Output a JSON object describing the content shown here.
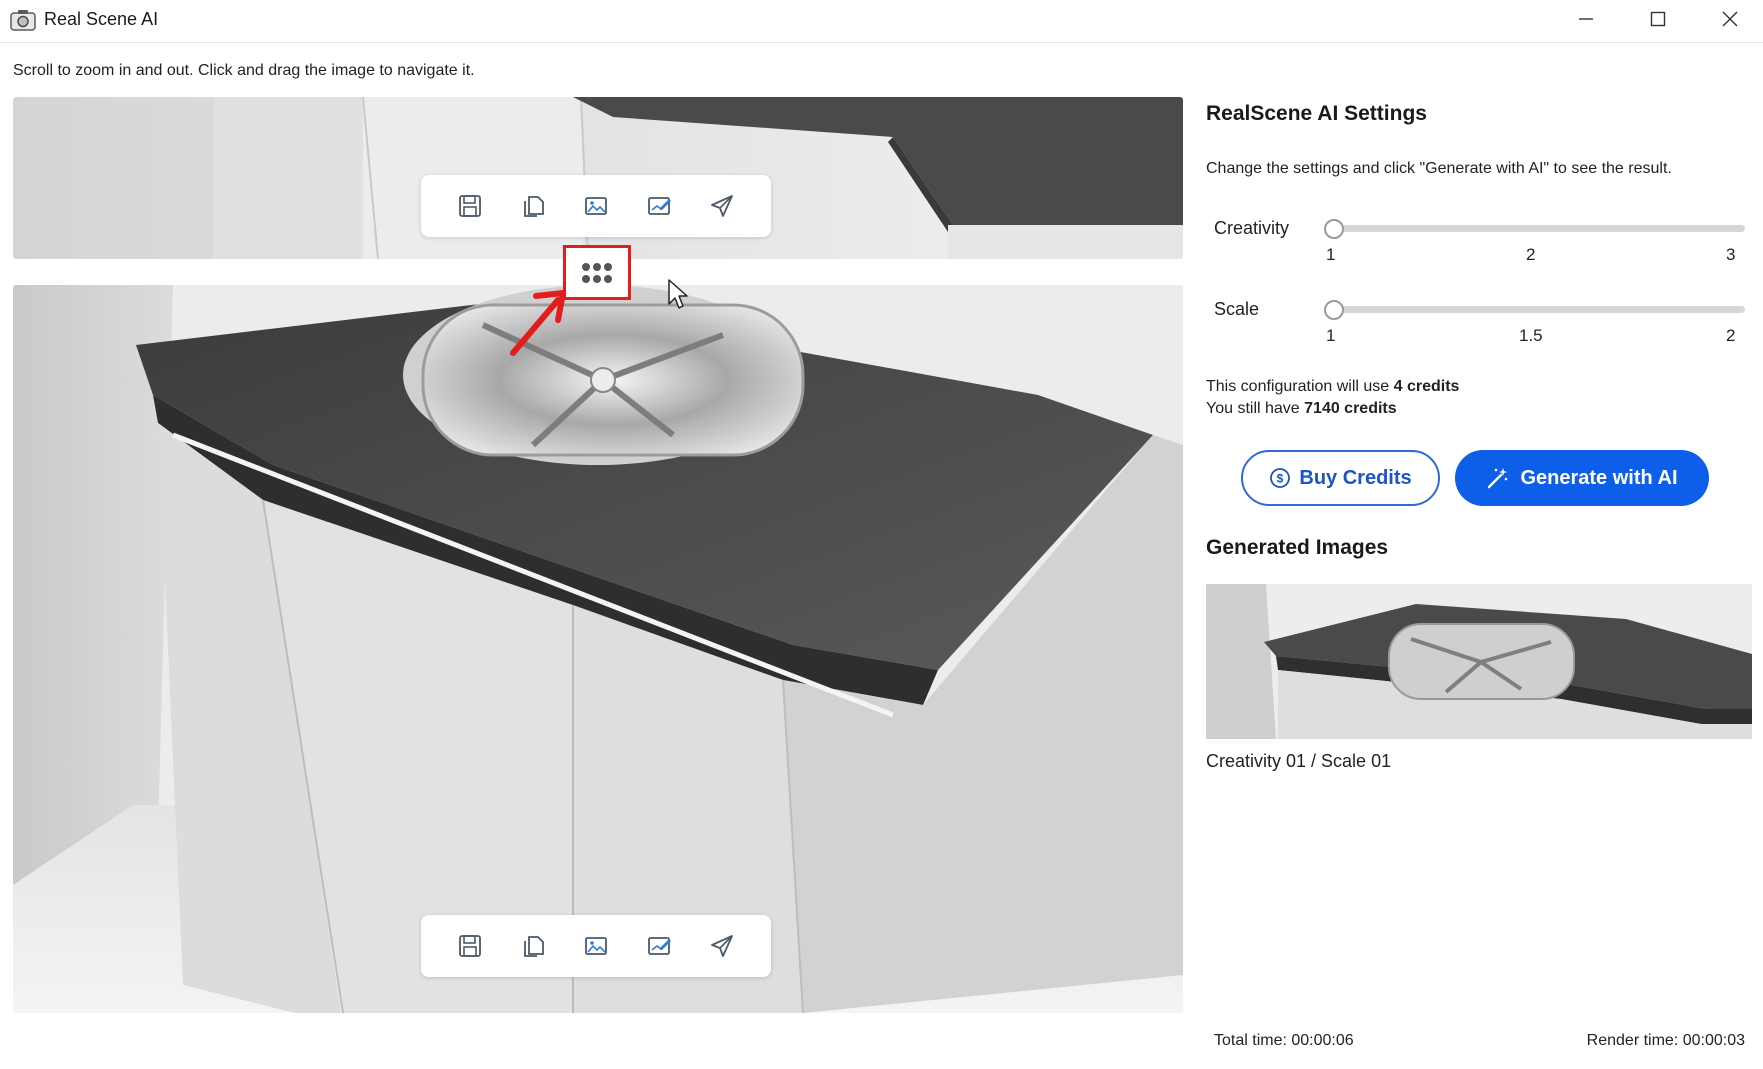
{
  "window": {
    "title": "Real Scene AI",
    "icon": "camera-icon"
  },
  "hint": "Scroll to zoom in and out. Click and drag the image to navigate it.",
  "toolbar": {
    "icons": [
      "save-icon",
      "copy-icon",
      "image-export-icon",
      "image-edit-icon",
      "send-icon"
    ]
  },
  "settings": {
    "title": "RealScene AI Settings",
    "description": "Change the settings and click \"Generate with AI\" to see the result.",
    "creativity": {
      "label": "Creativity",
      "ticks": [
        "1",
        "2",
        "3"
      ],
      "value": 1,
      "min": 1,
      "max": 3
    },
    "scale": {
      "label": "Scale",
      "ticks": [
        "1",
        "1.5",
        "2"
      ],
      "value": 1,
      "min": 1,
      "max": 2
    }
  },
  "credits": {
    "use_prefix": "This configuration will use ",
    "use_value": "4 credits",
    "have_prefix": "You still have ",
    "have_value": "7140 credits"
  },
  "buttons": {
    "buy": "Buy Credits",
    "generate": "Generate with AI"
  },
  "generated": {
    "title": "Generated Images",
    "items": [
      {
        "caption": "Creativity 01 / Scale 01"
      }
    ]
  },
  "footer": {
    "total_time": "Total time: 00:00:06",
    "render_time": "Render time: 00:00:03"
  },
  "colors": {
    "accent": "#0d5ee8",
    "annotation": "#e11d1d"
  }
}
